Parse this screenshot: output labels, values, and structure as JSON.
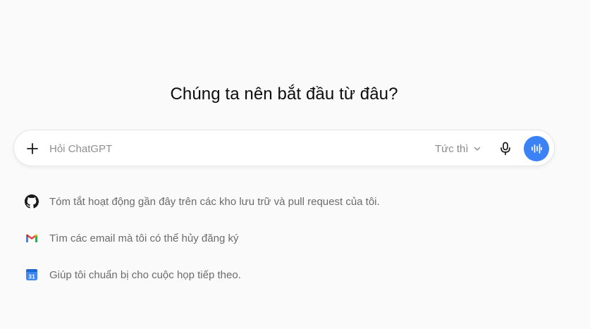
{
  "heading": "Chúng ta nên bắt đầu từ đâu?",
  "composer": {
    "placeholder": "Hỏi ChatGPT",
    "mode_label": "Tức thì",
    "icons": {
      "add": "plus-icon",
      "mode": "chevron-down-icon",
      "mic": "microphone-icon",
      "voice": "voice-waveform-icon"
    },
    "voice_button_color": "#3b82f6"
  },
  "suggestions": [
    {
      "icon": "github-icon",
      "text": "Tóm tắt hoạt động gần đây trên các kho lưu trữ và pull request của tôi."
    },
    {
      "icon": "gmail-icon",
      "text": "Tìm các email mà tôi có thể hủy đăng ký"
    },
    {
      "icon": "calendar-icon",
      "text": "Giúp tôi chuẩn bị cho cuộc họp tiếp theo.",
      "badge": "31"
    }
  ]
}
